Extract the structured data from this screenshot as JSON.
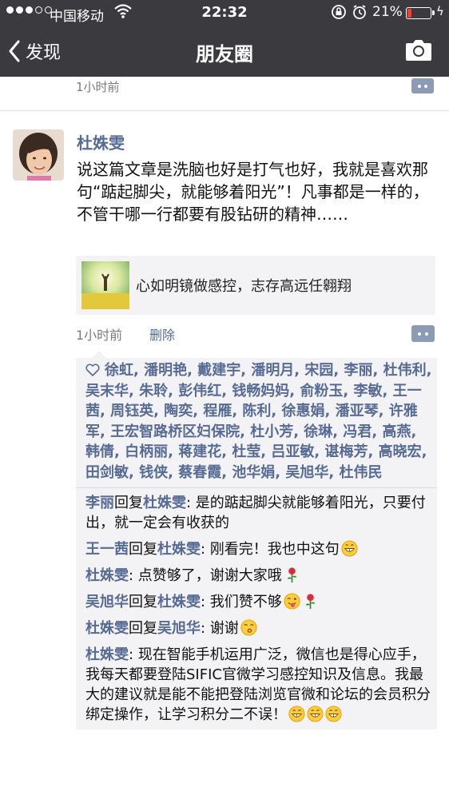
{
  "status_bar": {
    "carrier": "中国移动",
    "time": "22:32",
    "battery_percent": "21%",
    "battery_level": 0.21
  },
  "nav": {
    "back_label": "发现",
    "title": "朋友圈"
  },
  "previous_post": {
    "time": "1小时前"
  },
  "post": {
    "author": "杜姝雯",
    "text": "说这篇文章是洗脑也好是打气也好，我就是喜欢那句“踮起脚尖，就能够着阳光”！凡事都是一样的，不管干哪一行都要有股钻研的精神……",
    "link_title": "心如明镜做感控，志存高远任翱翔",
    "time": "1小时前",
    "delete_label": "删除"
  },
  "likes": "徐虹, 潘明艳, 戴建宇, 潘明月, 宋园, 李丽, 杜伟利, 吴末华, 朱聆, 彭伟红, 钱畅妈妈, 俞粉玉, 李敏, 王一茜, 周钰英, 陶奕, 程雁, 陈利, 徐惠娟, 潘亚琴, 许雅军, 王宏智路桥区妇保院, 杜小芳, 徐琳, 冯君, 高燕, 韩倩, 白柄丽, 蒋建花, 杜莹, 吕亚敏, 谌梅芳, 高晓宏, 田剑敏, 钱侠, 蔡春霞, 池华娟, 吴旭华, 杜伟民",
  "comments": [
    {
      "from": "李丽",
      "reply_word": "回复",
      "to": "杜姝雯",
      "text": ": 是的踮起脚尖就能够着阳光，只要付出，就一定会有收获的"
    },
    {
      "from": "王一茜",
      "reply_word": "回复",
      "to": "杜姝雯",
      "text": ": 刚看完！我也中这句"
    },
    {
      "from": "杜姝雯",
      "text": ": 点赞够了，谢谢大家哦"
    },
    {
      "from": "吴旭华",
      "reply_word": "回复",
      "to": "杜姝雯",
      "text": ": 我们赞不够"
    },
    {
      "from": "杜姝雯",
      "reply_word": "回复",
      "to": "吴旭华",
      "text": ": 谢谢"
    },
    {
      "from": "杜姝雯",
      "text": ": 现在智能手机运用广泛，微信也是得心应手，我每天都要登陆SIFIC官微学习感控知识及信息。我最大的建议就是能不能把登陆浏览官微和论坛的会员积分绑定操作，让学习积分二不误！"
    }
  ],
  "icons": {
    "back": "chevron-left-icon",
    "camera": "camera-icon",
    "comment": "comment-more-icon",
    "heart": "heart-outline-icon",
    "grin": "grinning-emoji-icon",
    "rose": "rose-emoji-icon",
    "wink": "tongue-wink-emoji-icon",
    "kiss": "kiss-emoji-icon"
  },
  "colors": {
    "nav_bg": "#3a3a3f",
    "name_blue": "#576b95",
    "panel_bg": "#f3f3f5",
    "battery_low": "#ff3b30"
  }
}
